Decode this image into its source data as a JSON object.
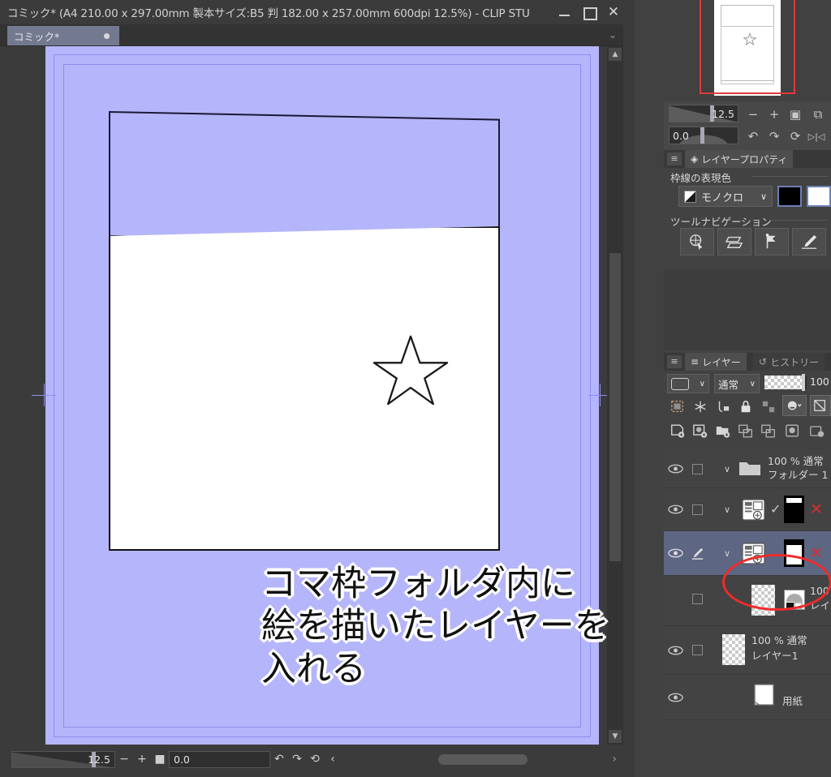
{
  "window": {
    "title": "コミック* (A4 210.00 x 297.00mm 製本サイズ:B5 判 182.00 x 257.00mm 600dpi 12.5%)  - CLIP STU",
    "minimize_label": "",
    "maximize_label": "",
    "close_label": "✕"
  },
  "doc_tab": {
    "label": "コミック*",
    "modified_dot": ""
  },
  "canvas": {
    "annotation_line1": "コマ枠フォルダ内に",
    "annotation_line2": "絵を描いたレイヤーを",
    "annotation_line3": "入れる",
    "paper_color": "#b5b5fb",
    "panel_border_color": "#191933"
  },
  "statusbar": {
    "zoom_value": "12.5",
    "zoom_minus": "−",
    "zoom_plus": "+",
    "zoom_fit": "■",
    "rotation_value": "0.0",
    "rotate_left": "↶",
    "rotate_right": "↷",
    "rotate_reset": "⟲",
    "collapse_left": "‹",
    "expand_right": "›"
  },
  "navigator": {
    "zoom_value": "12.5",
    "rotation_value": "0.0",
    "zoom_out": "−",
    "zoom_in": "+",
    "fit_screen": "▣",
    "rotate_left": "↶",
    "rotate_right": "↷",
    "rotate_reset": "⟳",
    "flip_horizontal": "▷|◁"
  },
  "layer_property": {
    "menu_icon": "≡",
    "tab_label": "レイヤープロパティ",
    "group_border_color": "枠線の表現色",
    "expression_value": "モノクロ",
    "dropdown_caret": "∨",
    "color_black": "#000000",
    "color_white": "#ffffff",
    "group_tool_nav": "ツールナビゲーション",
    "tool_buttons": [
      "object-select-icon",
      "transform-skew-icon",
      "control-point-icon",
      "pen-draw-icon"
    ]
  },
  "layer_palette": {
    "menu_icon": "≡",
    "tab_layer": "レイヤー",
    "tab_history": "ヒストリー",
    "blend_mode": "通常",
    "opacity_value": "100",
    "toolbar_icons": [
      "selection-from-layer-icon",
      "quick-mask-icon",
      "ruler-lock-icon",
      "lock-layer-icon",
      "lock-transparent-icon",
      "mask-enable-icon",
      "mask-disable-icon",
      "new-raster-layer-icon",
      "new-tone-layer-icon",
      "new-folder-icon",
      "transfer-down-icon",
      "combine-down-icon",
      "mask-create-icon",
      "mask-apply-icon"
    ],
    "rows": [
      {
        "name": "layer-folder-1",
        "info": "100 % 通常",
        "label": "フォルダー 1",
        "thumb": "folder-icon",
        "selected": false,
        "has_eye": true,
        "has_check": false,
        "expander": "∨"
      },
      {
        "name": "frame-border-layer-upper",
        "info": "",
        "label": "",
        "thumb": "frame-border-icon",
        "selected": false,
        "has_eye": true,
        "has_check": true,
        "expander": "∨",
        "mask_x": "✕"
      },
      {
        "name": "frame-border-layer-lower",
        "info": "",
        "label": "",
        "thumb": "frame-border-icon",
        "selected": true,
        "has_eye": true,
        "has_check": false,
        "expander": "∨",
        "mask_x": "✕"
      },
      {
        "name": "drawing-layer-inside-folder",
        "info": "100",
        "label": "レイ",
        "thumb": "transparent-checker",
        "selected": false,
        "has_eye": false,
        "has_check": false,
        "expander": ""
      },
      {
        "name": "layer-1",
        "info": "100 % 通常",
        "label": "レイヤー1",
        "thumb": "transparent-checker",
        "selected": false,
        "has_eye": true,
        "has_check": true,
        "expander": ""
      },
      {
        "name": "paper-layer",
        "info": "",
        "label": "用紙",
        "thumb": "paper-icon",
        "selected": false,
        "has_eye": true,
        "has_check": false,
        "expander": ""
      }
    ],
    "highlight_color": "#ef2b2b"
  }
}
